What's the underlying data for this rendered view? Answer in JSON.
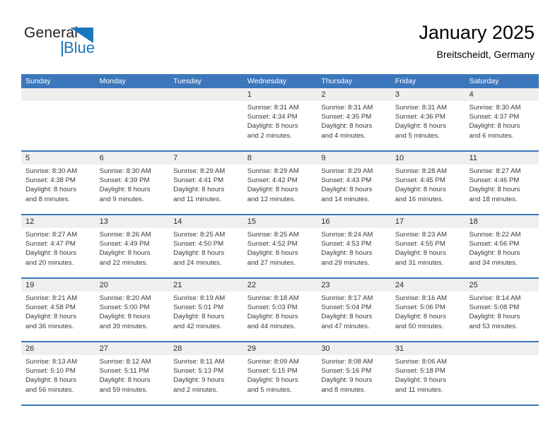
{
  "brand": {
    "name_part1": "General",
    "name_part2": "Blue",
    "logo_icon": "triangle-logo-icon"
  },
  "header": {
    "title": "January 2025",
    "subtitle": "Breitscheidt, Germany"
  },
  "colors": {
    "header_blue": "#3c77bc",
    "brand_blue": "#1b77bd",
    "row_band": "#efefef"
  },
  "calendar": {
    "day_headers": [
      "Sunday",
      "Monday",
      "Tuesday",
      "Wednesday",
      "Thursday",
      "Friday",
      "Saturday"
    ],
    "weeks": [
      [
        {
          "day": "",
          "lines": []
        },
        {
          "day": "",
          "lines": []
        },
        {
          "day": "",
          "lines": []
        },
        {
          "day": "1",
          "lines": [
            "Sunrise: 8:31 AM",
            "Sunset: 4:34 PM",
            "Daylight: 8 hours",
            "and 2 minutes."
          ]
        },
        {
          "day": "2",
          "lines": [
            "Sunrise: 8:31 AM",
            "Sunset: 4:35 PM",
            "Daylight: 8 hours",
            "and 4 minutes."
          ]
        },
        {
          "day": "3",
          "lines": [
            "Sunrise: 8:31 AM",
            "Sunset: 4:36 PM",
            "Daylight: 8 hours",
            "and 5 minutes."
          ]
        },
        {
          "day": "4",
          "lines": [
            "Sunrise: 8:30 AM",
            "Sunset: 4:37 PM",
            "Daylight: 8 hours",
            "and 6 minutes."
          ]
        }
      ],
      [
        {
          "day": "5",
          "lines": [
            "Sunrise: 8:30 AM",
            "Sunset: 4:38 PM",
            "Daylight: 8 hours",
            "and 8 minutes."
          ]
        },
        {
          "day": "6",
          "lines": [
            "Sunrise: 8:30 AM",
            "Sunset: 4:39 PM",
            "Daylight: 8 hours",
            "and 9 minutes."
          ]
        },
        {
          "day": "7",
          "lines": [
            "Sunrise: 8:29 AM",
            "Sunset: 4:41 PM",
            "Daylight: 8 hours",
            "and 11 minutes."
          ]
        },
        {
          "day": "8",
          "lines": [
            "Sunrise: 8:29 AM",
            "Sunset: 4:42 PM",
            "Daylight: 8 hours",
            "and 12 minutes."
          ]
        },
        {
          "day": "9",
          "lines": [
            "Sunrise: 8:29 AM",
            "Sunset: 4:43 PM",
            "Daylight: 8 hours",
            "and 14 minutes."
          ]
        },
        {
          "day": "10",
          "lines": [
            "Sunrise: 8:28 AM",
            "Sunset: 4:45 PM",
            "Daylight: 8 hours",
            "and 16 minutes."
          ]
        },
        {
          "day": "11",
          "lines": [
            "Sunrise: 8:27 AM",
            "Sunset: 4:46 PM",
            "Daylight: 8 hours",
            "and 18 minutes."
          ]
        }
      ],
      [
        {
          "day": "12",
          "lines": [
            "Sunrise: 8:27 AM",
            "Sunset: 4:47 PM",
            "Daylight: 8 hours",
            "and 20 minutes."
          ]
        },
        {
          "day": "13",
          "lines": [
            "Sunrise: 8:26 AM",
            "Sunset: 4:49 PM",
            "Daylight: 8 hours",
            "and 22 minutes."
          ]
        },
        {
          "day": "14",
          "lines": [
            "Sunrise: 8:25 AM",
            "Sunset: 4:50 PM",
            "Daylight: 8 hours",
            "and 24 minutes."
          ]
        },
        {
          "day": "15",
          "lines": [
            "Sunrise: 8:25 AM",
            "Sunset: 4:52 PM",
            "Daylight: 8 hours",
            "and 27 minutes."
          ]
        },
        {
          "day": "16",
          "lines": [
            "Sunrise: 8:24 AM",
            "Sunset: 4:53 PM",
            "Daylight: 8 hours",
            "and 29 minutes."
          ]
        },
        {
          "day": "17",
          "lines": [
            "Sunrise: 8:23 AM",
            "Sunset: 4:55 PM",
            "Daylight: 8 hours",
            "and 31 minutes."
          ]
        },
        {
          "day": "18",
          "lines": [
            "Sunrise: 8:22 AM",
            "Sunset: 4:56 PM",
            "Daylight: 8 hours",
            "and 34 minutes."
          ]
        }
      ],
      [
        {
          "day": "19",
          "lines": [
            "Sunrise: 8:21 AM",
            "Sunset: 4:58 PM",
            "Daylight: 8 hours",
            "and 36 minutes."
          ]
        },
        {
          "day": "20",
          "lines": [
            "Sunrise: 8:20 AM",
            "Sunset: 5:00 PM",
            "Daylight: 8 hours",
            "and 39 minutes."
          ]
        },
        {
          "day": "21",
          "lines": [
            "Sunrise: 8:19 AM",
            "Sunset: 5:01 PM",
            "Daylight: 8 hours",
            "and 42 minutes."
          ]
        },
        {
          "day": "22",
          "lines": [
            "Sunrise: 8:18 AM",
            "Sunset: 5:03 PM",
            "Daylight: 8 hours",
            "and 44 minutes."
          ]
        },
        {
          "day": "23",
          "lines": [
            "Sunrise: 8:17 AM",
            "Sunset: 5:04 PM",
            "Daylight: 8 hours",
            "and 47 minutes."
          ]
        },
        {
          "day": "24",
          "lines": [
            "Sunrise: 8:16 AM",
            "Sunset: 5:06 PM",
            "Daylight: 8 hours",
            "and 50 minutes."
          ]
        },
        {
          "day": "25",
          "lines": [
            "Sunrise: 8:14 AM",
            "Sunset: 5:08 PM",
            "Daylight: 8 hours",
            "and 53 minutes."
          ]
        }
      ],
      [
        {
          "day": "26",
          "lines": [
            "Sunrise: 8:13 AM",
            "Sunset: 5:10 PM",
            "Daylight: 8 hours",
            "and 56 minutes."
          ]
        },
        {
          "day": "27",
          "lines": [
            "Sunrise: 8:12 AM",
            "Sunset: 5:11 PM",
            "Daylight: 8 hours",
            "and 59 minutes."
          ]
        },
        {
          "day": "28",
          "lines": [
            "Sunrise: 8:11 AM",
            "Sunset: 5:13 PM",
            "Daylight: 9 hours",
            "and 2 minutes."
          ]
        },
        {
          "day": "29",
          "lines": [
            "Sunrise: 8:09 AM",
            "Sunset: 5:15 PM",
            "Daylight: 9 hours",
            "and 5 minutes."
          ]
        },
        {
          "day": "30",
          "lines": [
            "Sunrise: 8:08 AM",
            "Sunset: 5:16 PM",
            "Daylight: 9 hours",
            "and 8 minutes."
          ]
        },
        {
          "day": "31",
          "lines": [
            "Sunrise: 8:06 AM",
            "Sunset: 5:18 PM",
            "Daylight: 9 hours",
            "and 11 minutes."
          ]
        },
        {
          "day": "",
          "lines": []
        }
      ]
    ]
  }
}
